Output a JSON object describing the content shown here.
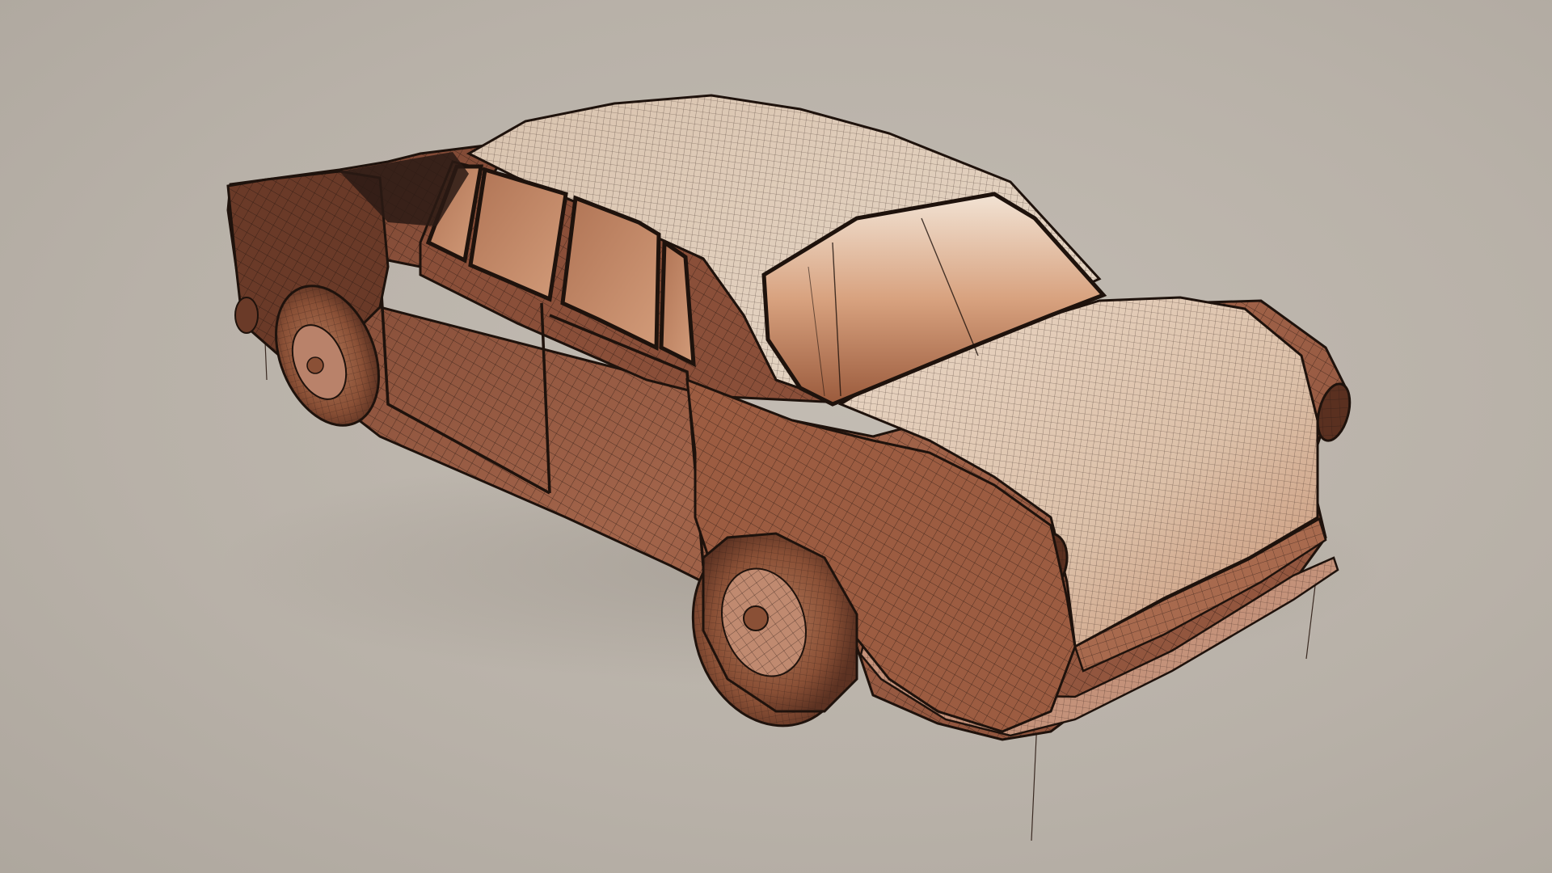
{
  "scene": {
    "subject": "car-wireframe-model",
    "colors": {
      "background": "#bab3aa",
      "body": "#a8694a",
      "body_highlight": "#e6c7ad",
      "body_shadow": "#5a3020",
      "glass": "#c98f6c",
      "glass_light": "#f3e6d8",
      "tire": "#6b3a26",
      "wire": "#2a1a14"
    }
  }
}
